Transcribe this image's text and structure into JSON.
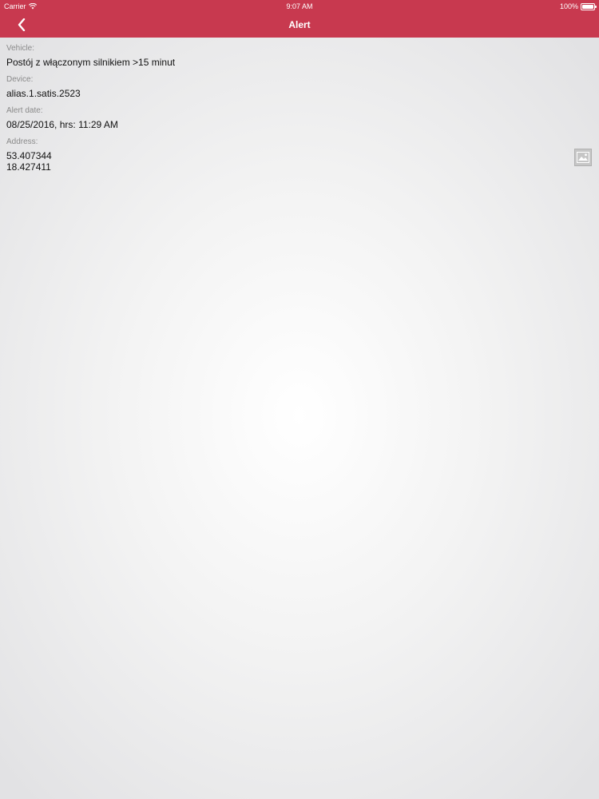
{
  "status_bar": {
    "carrier": "Carrier",
    "time": "9:07 AM",
    "battery": "100%"
  },
  "nav": {
    "title": "Alert",
    "back_icon": "chevron-left-icon"
  },
  "fields": {
    "vehicle_label": "Vehicle:",
    "vehicle_value": "Postój z włączonym silnikiem >15 minut",
    "device_label": "Device:",
    "device_value": "alias.1.satis.2523",
    "date_label": "Alert date:",
    "date_value": "08/25/2016, hrs: 11:29 AM",
    "address_label": "Address:",
    "address_lat": "53.407344",
    "address_lon": "18.427411"
  },
  "map_button": {
    "icon": "map-icon"
  },
  "colors": {
    "accent": "#c8394f"
  }
}
